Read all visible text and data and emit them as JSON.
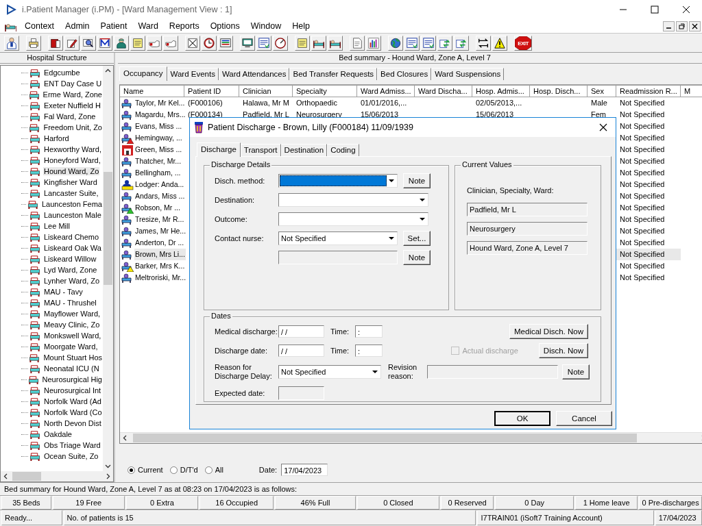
{
  "app": {
    "title": "i.Patient Manager (i.PM) - [Ward Management View : 1]"
  },
  "menu": [
    "Context",
    "Admin",
    "Patient",
    "Ward",
    "Reports",
    "Options",
    "Window",
    "Help"
  ],
  "toolbar": [
    [
      {
        "kind": "person"
      }
    ],
    [
      {
        "kind": "printer"
      }
    ],
    [
      {
        "kind": "book"
      },
      {
        "kind": "pencil"
      },
      {
        "kind": "magnifier"
      },
      {
        "kind": "letter"
      },
      {
        "kind": "doctor"
      },
      {
        "kind": "notepad"
      },
      {
        "kind": "hand"
      },
      {
        "kind": "hand"
      }
    ],
    [
      {
        "kind": "scissors"
      },
      {
        "kind": "clock"
      },
      {
        "kind": "monitor"
      }
    ],
    [
      {
        "kind": "screen"
      },
      {
        "kind": "form"
      },
      {
        "kind": "gauge"
      }
    ],
    [
      {
        "kind": "notepad"
      },
      {
        "kind": "bed"
      },
      {
        "kind": "bed"
      }
    ],
    [
      {
        "kind": "document"
      },
      {
        "kind": "chart"
      }
    ],
    [
      {
        "kind": "globe"
      },
      {
        "kind": "form"
      },
      {
        "kind": "form"
      },
      {
        "kind": "arrows"
      },
      {
        "kind": "arrows"
      }
    ],
    [
      {
        "kind": "swap"
      },
      {
        "kind": "warning"
      }
    ],
    [
      {
        "kind": "exit",
        "label": "EXIT"
      }
    ]
  ],
  "tree": {
    "header": "Hospital Structure",
    "items": [
      {
        "label": "Edgcumbe",
        "selected": false
      },
      {
        "label": "ENT Day Case U",
        "selected": false
      },
      {
        "label": "Erme Ward, Zone",
        "selected": false
      },
      {
        "label": "Exeter Nuffield H",
        "selected": false
      },
      {
        "label": "Fal Ward, Zone",
        "selected": false
      },
      {
        "label": "Freedom Unit, Zo",
        "selected": false
      },
      {
        "label": "Harford",
        "selected": false
      },
      {
        "label": "Hexworthy Ward,",
        "selected": false
      },
      {
        "label": "Honeyford Ward,",
        "selected": false
      },
      {
        "label": "Hound Ward, Zo",
        "selected": true
      },
      {
        "label": "Kingfisher Ward",
        "selected": false
      },
      {
        "label": "Lancaster Suite,",
        "selected": false
      },
      {
        "label": "Launceston Fema",
        "selected": false
      },
      {
        "label": "Launceston Male",
        "selected": false
      },
      {
        "label": "Lee Mill",
        "selected": false
      },
      {
        "label": "Liskeard Chemo",
        "selected": false
      },
      {
        "label": "Liskeard Oak Wa",
        "selected": false
      },
      {
        "label": "Liskeard Willow",
        "selected": false
      },
      {
        "label": "Lyd Ward, Zone",
        "selected": false
      },
      {
        "label": "Lynher Ward, Zo",
        "selected": false
      },
      {
        "label": "MAU - Tavy",
        "selected": false
      },
      {
        "label": "MAU - Thrushel",
        "selected": false
      },
      {
        "label": "Mayflower Ward,",
        "selected": false
      },
      {
        "label": "Meavy Clinic, Zo",
        "selected": false
      },
      {
        "label": "Monkswell Ward,",
        "selected": false
      },
      {
        "label": "Moorgate Ward,",
        "selected": false
      },
      {
        "label": "Mount Stuart Hos",
        "selected": false
      },
      {
        "label": "Neonatal ICU (N",
        "selected": false
      },
      {
        "label": "Neurosurgical Hig",
        "selected": false
      },
      {
        "label": "Neurosurgical Int",
        "selected": false
      },
      {
        "label": "Norfolk Ward (Ad",
        "selected": false
      },
      {
        "label": "Norfolk Ward (Co",
        "selected": false
      },
      {
        "label": "North Devon Dist",
        "selected": false
      },
      {
        "label": "Oakdale",
        "selected": false
      },
      {
        "label": "Obs Triage Ward",
        "selected": false
      },
      {
        "label": "Ocean Suite, Zo",
        "selected": false
      }
    ]
  },
  "view": {
    "title": "Bed summary - Hound Ward, Zone A, Level 7",
    "tabs": [
      {
        "label": "Occupancy",
        "selected": true
      },
      {
        "label": "Ward Events",
        "selected": false
      },
      {
        "label": "Ward Attendances",
        "selected": false
      },
      {
        "label": "Bed Transfer Requests",
        "selected": false
      },
      {
        "label": "Bed Closures",
        "selected": false
      },
      {
        "label": "Ward Suspensions",
        "selected": false
      }
    ],
    "table": {
      "columns": [
        "Name",
        "Patient ID",
        "Clinician",
        "Specialty",
        "Ward Admiss...",
        "Ward Discha...",
        "Hosp. Admis...",
        "Hosp. Disch...",
        "Sex",
        "Readmission R...",
        "M"
      ],
      "rows": [
        {
          "kind": "bed",
          "selected": false,
          "cells": [
            "Taylor, Mr Kel...",
            "(F000106)",
            "Halawa, Mr M",
            "Orthopaedic",
            "01/01/2016,...",
            null,
            "02/05/2013,...",
            null,
            "Male",
            "Not Specified"
          ]
        },
        {
          "kind": "bed",
          "selected": false,
          "cells": [
            "Magardu, Mrs...",
            "(F000134)",
            "Padfield, Mr L",
            "Neurosurgery",
            "15/06/2013",
            null,
            "15/06/2013",
            null,
            "Fem",
            "Not Specified"
          ]
        },
        {
          "kind": "bed",
          "selected": false,
          "cells": [
            "Evans, Miss ...",
            null,
            null,
            null,
            null,
            null,
            null,
            null,
            null,
            "Not Specified"
          ]
        },
        {
          "kind": "redalert",
          "selected": false,
          "cells": [
            "Hemingway, ...",
            null,
            null,
            null,
            null,
            null,
            null,
            null,
            null,
            "Not Specified"
          ]
        },
        {
          "kind": "house",
          "selected": false,
          "cells": [
            "Green, Miss ...",
            null,
            null,
            null,
            null,
            null,
            null,
            null,
            null,
            "Not Specified"
          ]
        },
        {
          "kind": "bed",
          "selected": false,
          "cells": [
            "Thatcher, Mr...",
            null,
            null,
            null,
            null,
            null,
            null,
            null,
            null,
            "Not Specified"
          ]
        },
        {
          "kind": "bed",
          "selected": false,
          "cells": [
            "Bellingham, ...",
            null,
            null,
            null,
            null,
            null,
            null,
            null,
            null,
            "Not Specified"
          ]
        },
        {
          "kind": "lodger",
          "selected": false,
          "cells": [
            "Lodger: Anda...",
            null,
            null,
            null,
            null,
            null,
            null,
            null,
            null,
            "Not Specified"
          ]
        },
        {
          "kind": "bed",
          "selected": false,
          "cells": [
            "Andars, Miss ...",
            null,
            null,
            null,
            null,
            null,
            null,
            null,
            null,
            "Not Specified"
          ]
        },
        {
          "kind": "greenalert",
          "selected": false,
          "cells": [
            "Robson, Mr ...",
            null,
            null,
            null,
            null,
            null,
            null,
            null,
            null,
            "Not Specified"
          ]
        },
        {
          "kind": "bed",
          "selected": false,
          "cells": [
            "Tresize, Mr R...",
            null,
            null,
            null,
            null,
            null,
            null,
            null,
            null,
            "Not Specified"
          ]
        },
        {
          "kind": "bed",
          "selected": false,
          "cells": [
            "James, Mr He...",
            null,
            null,
            null,
            null,
            null,
            null,
            null,
            null,
            "Not Specified"
          ]
        },
        {
          "kind": "bed",
          "selected": false,
          "cells": [
            "Anderton, Dr ...",
            null,
            null,
            null,
            null,
            null,
            null,
            null,
            null,
            "Not Specified"
          ]
        },
        {
          "kind": "bed",
          "selected": true,
          "cells": [
            "Brown, Mrs Li...",
            null,
            null,
            null,
            null,
            null,
            null,
            null,
            null,
            "Not Specified"
          ]
        },
        {
          "kind": "yellowalert",
          "selected": false,
          "cells": [
            "Barker, Mrs K...",
            null,
            null,
            null,
            null,
            null,
            null,
            null,
            null,
            "Not Specified"
          ]
        },
        {
          "kind": "bed",
          "selected": false,
          "cells": [
            "Meltroriski, Mr...",
            null,
            null,
            null,
            null,
            null,
            null,
            null,
            null,
            "Not Specified"
          ]
        }
      ]
    },
    "filters": [
      {
        "label": "Current",
        "selected": true
      },
      {
        "label": "D/T'd",
        "selected": false
      },
      {
        "label": "All",
        "selected": false
      }
    ],
    "date": {
      "label": "Date:",
      "value": "17/04/2023"
    }
  },
  "dialog": {
    "title": "Patient Discharge - Brown, Lilly (F000184) 11/09/1939",
    "tabs": [
      {
        "label": "Discharge",
        "selected": true
      },
      {
        "label": "Transport",
        "selected": false
      },
      {
        "label": "Destination",
        "selected": false
      },
      {
        "label": "Coding",
        "selected": false
      }
    ],
    "details": {
      "legend": "Discharge Details",
      "rows": [
        {
          "kind": "select",
          "label": "Disch. method:",
          "highlighted": true,
          "button": "Note"
        },
        {
          "kind": "select",
          "label": "Destination:",
          "highlighted": false
        },
        {
          "kind": "select",
          "label": "Outcome:",
          "highlighted": false
        },
        {
          "kind": "select",
          "label": "Contact nurse:",
          "value": "Not Specified",
          "highlighted": false,
          "button": "Set..."
        },
        {
          "kind": "text",
          "button": "Note"
        }
      ]
    },
    "current": {
      "legend": "Current Values",
      "label": "Clinician, Specialty, Ward:",
      "values": [
        "Padfield, Mr L",
        "Neurosurgery",
        "Hound Ward, Zone A, Level 7"
      ]
    },
    "dates": {
      "legend": "Dates",
      "medical": {
        "label": "Medical discharge:",
        "value": "/ /",
        "time_label": "Time:",
        "time": ":",
        "button": "Medical Disch. Now"
      },
      "discharge": {
        "label": "Discharge date:",
        "value": "/ /",
        "time_label": "Time:",
        "time": ":",
        "button": "Disch. Now"
      },
      "actual": {
        "label": "Actual discharge",
        "checked": false,
        "disabled": true
      },
      "delay": {
        "label": "Reason for Discharge Delay:",
        "value": "Not Specified"
      },
      "revision": {
        "label": "Revision reason:",
        "button": "Note"
      },
      "expected": {
        "label": "Expected date:"
      }
    },
    "buttons": [
      "OK",
      "Cancel"
    ]
  },
  "summary": "Bed summary for Hound Ward, Zone A, Level 7 as at 08:23 on 17/04/2023 is as follows:",
  "stats": [
    "35 Beds",
    "19 Free",
    "0 Extra",
    "16 Occupied",
    "46% Full",
    "0 Closed",
    "0 Reserved",
    "0 Day",
    "1 Home leave",
    "0 Pre-discharges"
  ],
  "status": [
    "Ready...",
    "No. of patients is 15",
    "I7TRAIN01 (iSoft7 Training Account)",
    "17/04/2023"
  ]
}
